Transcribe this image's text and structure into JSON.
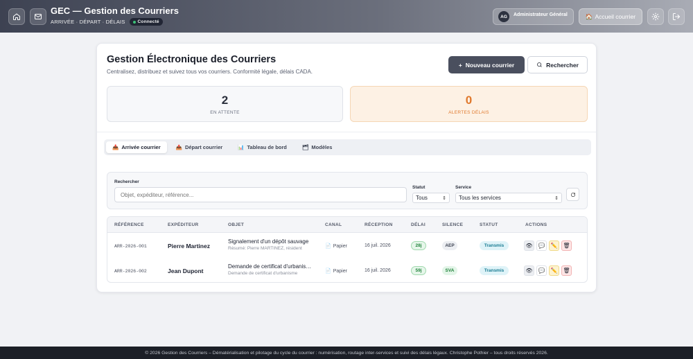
{
  "header": {
    "title": "GEC — Gestion des Courriers",
    "subtitle": "ARRIVÉE · DÉPART · DÉLAIS",
    "status_badge": "Connecté",
    "user_initials": "AG",
    "user_name": "Administrateur Général",
    "home_label": "Accueil courrier"
  },
  "page": {
    "title": "Gestion Électronique des Courriers",
    "description": "Centralisez, distribuez et suivez tous vos courriers. Conformité légale, délais CADA.",
    "new_button": "Nouveau courrier",
    "search_button": "Rechercher"
  },
  "stats": {
    "waiting_value": "2",
    "waiting_label": "EN ATTENTE",
    "alerts_value": "0",
    "alerts_label": "ALERTES DÉLAIS"
  },
  "tabs": [
    {
      "icon": "📥",
      "label": "Arrivée courrier"
    },
    {
      "icon": "📤",
      "label": "Départ courrier"
    },
    {
      "icon": "📊",
      "label": "Tableau de bord"
    },
    {
      "icon": "🗂",
      "label": "Modèles"
    }
  ],
  "filters": {
    "search_label": "Rechercher",
    "search_placeholder": "Objet, expéditeur, référence...",
    "status_label": "Statut",
    "status_value": "Tous",
    "service_label": "Service",
    "service_value": "Tous les services"
  },
  "table": {
    "columns": [
      "RÉFÉRENCE",
      "EXPÉDITEUR",
      "OBJET",
      "CANAL",
      "RÉCEPTION",
      "DÉLAI",
      "SILENCE",
      "STATUT",
      "ACTIONS"
    ],
    "rows": [
      {
        "ref": "ARR-2026-001",
        "sender": "Pierre Martinez",
        "object": "Signalement d'un dépôt sauvage",
        "summary": "Résumé: Pierre MARTINEZ, résident",
        "channel": "Papier",
        "received": "16 juil. 2026",
        "delay": "28j",
        "silence": "AEP",
        "status": "Transmis"
      },
      {
        "ref": "ARR-2026-002",
        "sender": "Jean Dupont",
        "object": "Demande de certificat d'urbanisme",
        "summary": "Demande de certificat d'urbanisme",
        "channel": "Papier",
        "received": "16 juil. 2026",
        "delay": "59j",
        "silence": "SVA",
        "status": "Transmis"
      }
    ]
  },
  "footer": {
    "text": "© 2026 Gestion des Courriers – Dématérialisation et pilotage du cycle du courrier : numérisation, routage inter-services et suivi des délais légaux. Christophe Pothier – tous droits réservés 2026."
  }
}
